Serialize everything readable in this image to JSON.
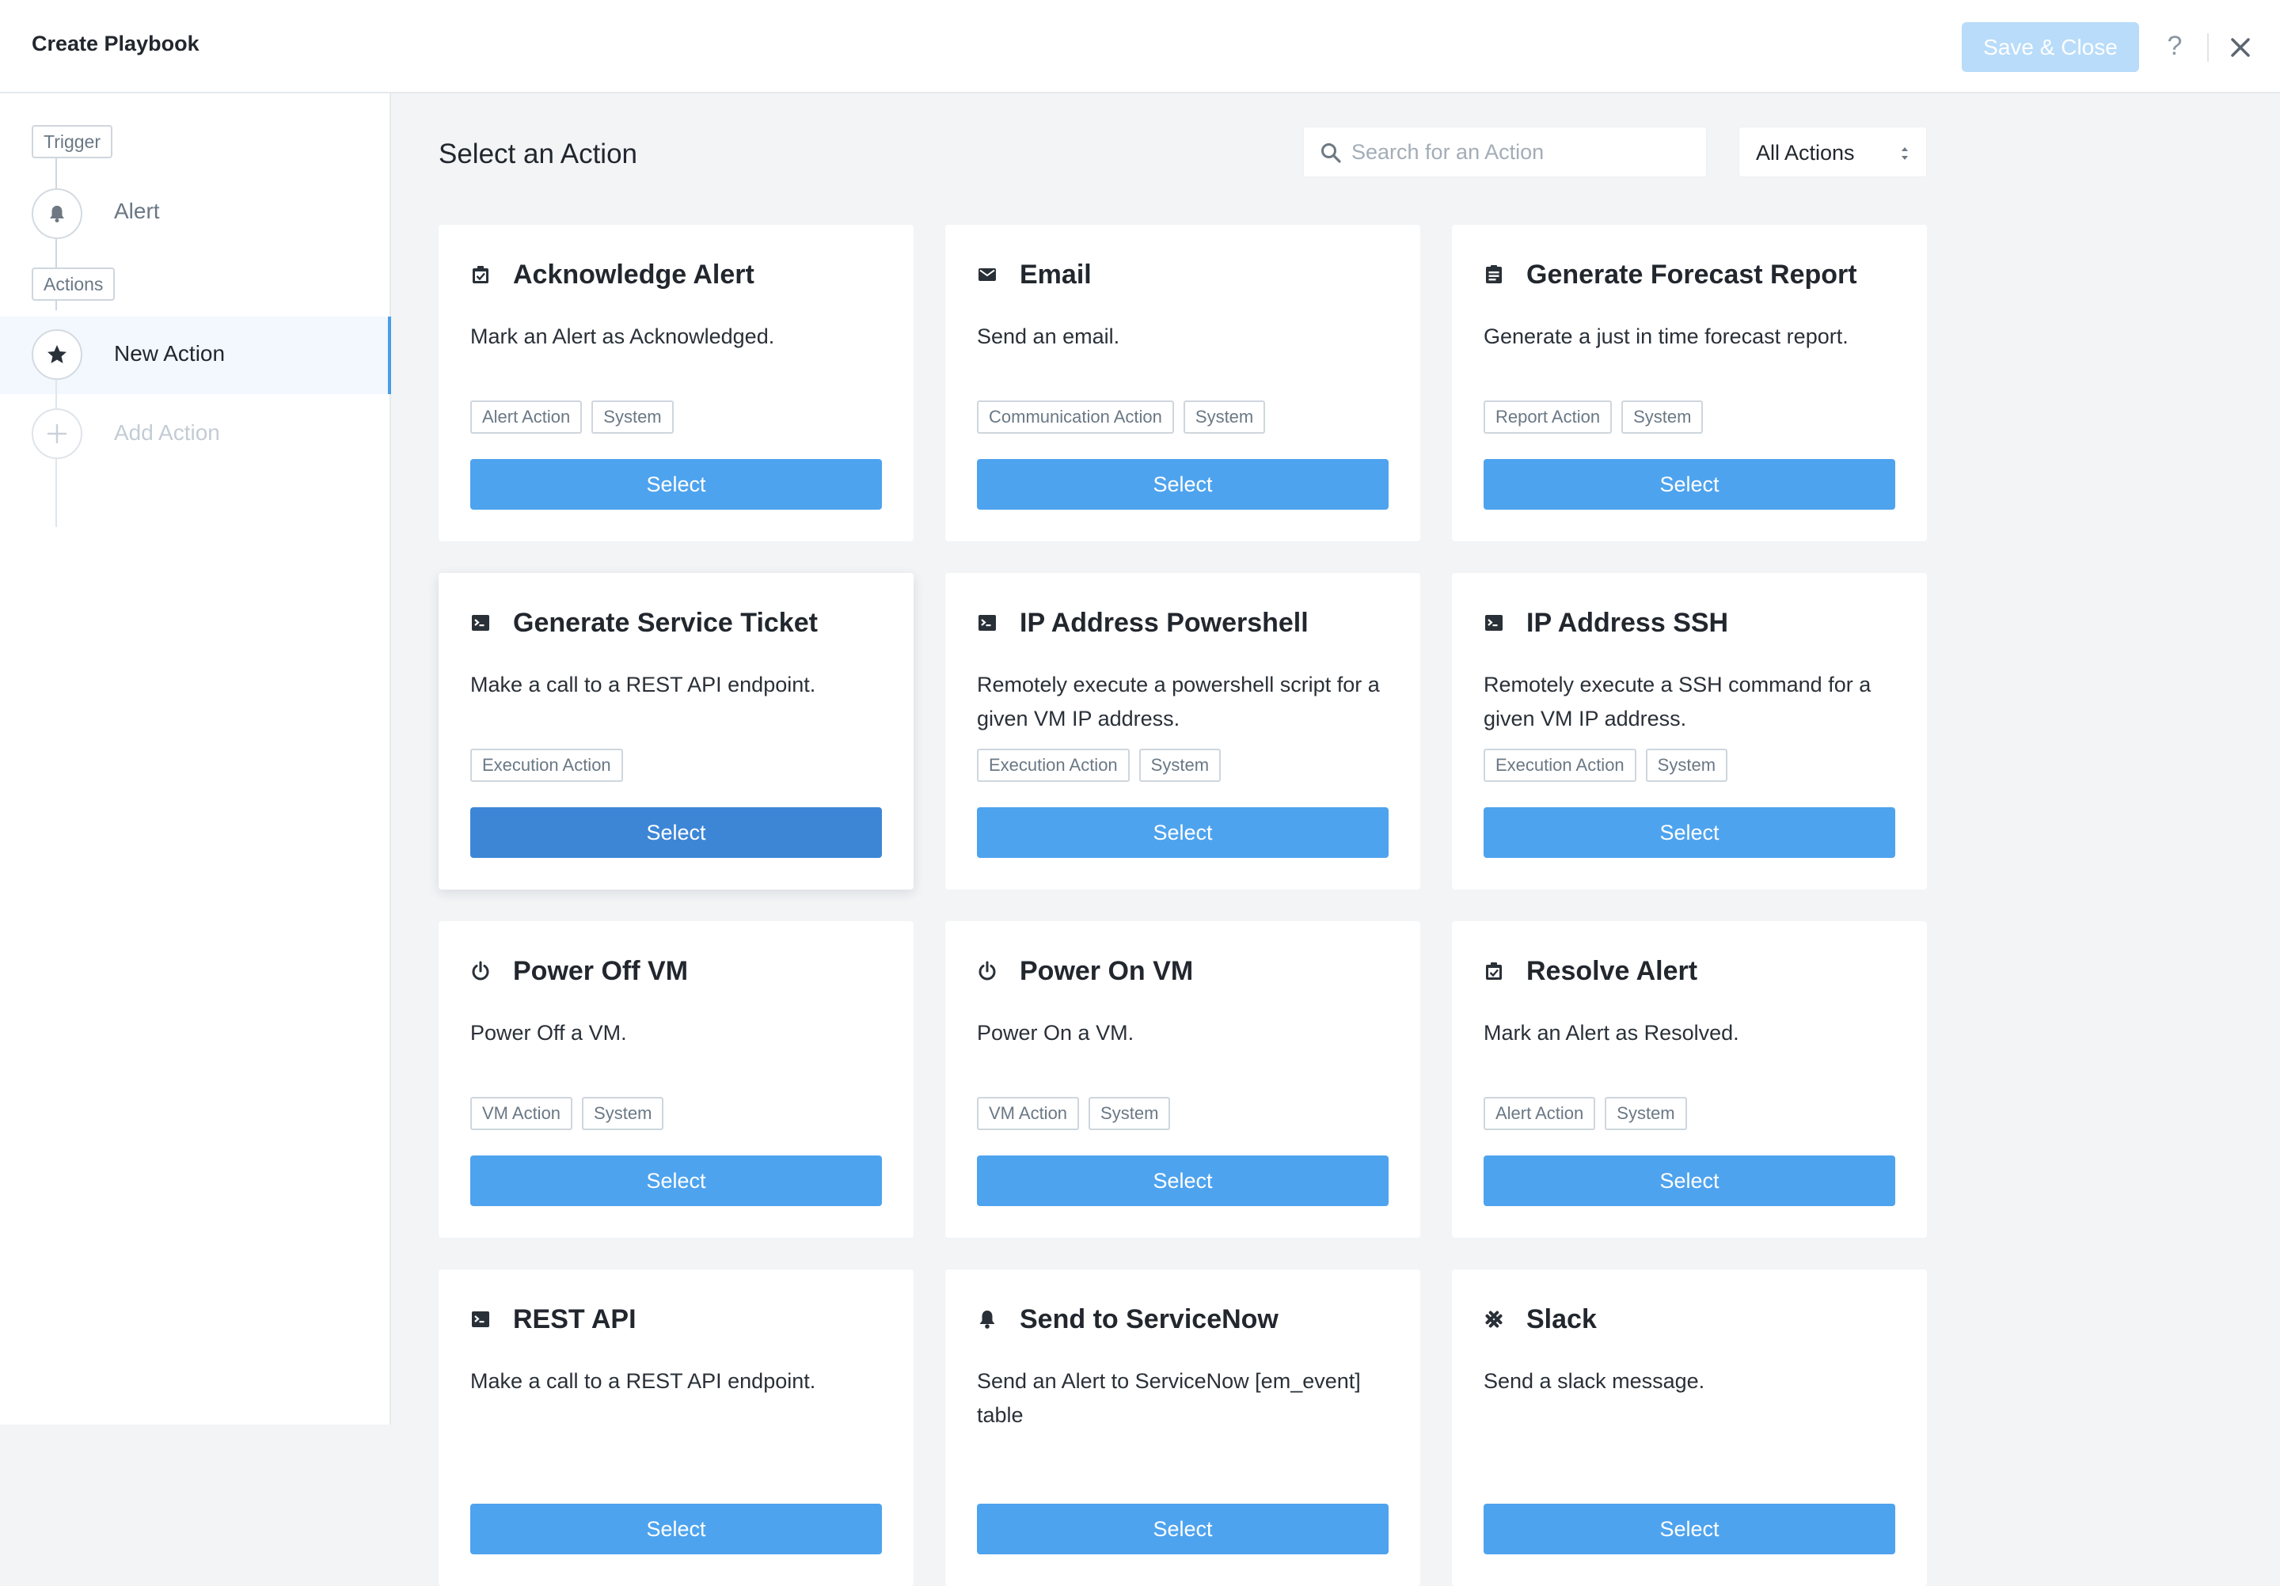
{
  "header": {
    "title": "Create Playbook",
    "save_label": "Save & Close",
    "help_label": "?"
  },
  "sidebar": {
    "trigger_label": "Trigger",
    "trigger_item": "Alert",
    "actions_label": "Actions",
    "new_action": "New Action",
    "add_action": "Add Action"
  },
  "main": {
    "title": "Select an Action",
    "search_placeholder": "Search for an Action",
    "filter_value": "All Actions",
    "cards": [
      {
        "title": "Acknowledge Alert",
        "desc": "Mark an Alert as Acknowledged.",
        "tags": [
          "Alert Action",
          "System"
        ],
        "icon": "clipboard-check-icon",
        "button": "Select"
      },
      {
        "title": "Email",
        "desc": "Send an email.",
        "tags": [
          "Communication Action",
          "System"
        ],
        "icon": "envelope-icon",
        "button": "Select"
      },
      {
        "title": "Generate Forecast Report",
        "desc": "Generate a just in time forecast report.",
        "tags": [
          "Report Action",
          "System"
        ],
        "icon": "report-icon",
        "button": "Select"
      },
      {
        "title": "Generate Service Ticket",
        "desc": "Make a call to a REST API endpoint.",
        "tags": [
          "Execution Action"
        ],
        "icon": "terminal-icon",
        "button": "Select"
      },
      {
        "title": "IP Address Powershell",
        "desc": "Remotely execute a powershell script for a given VM IP address.",
        "tags": [
          "Execution Action",
          "System"
        ],
        "icon": "terminal-icon",
        "button": "Select"
      },
      {
        "title": "IP Address SSH",
        "desc": "Remotely execute a SSH command for a given VM IP address.",
        "tags": [
          "Execution Action",
          "System"
        ],
        "icon": "terminal-icon",
        "button": "Select"
      },
      {
        "title": "Power Off VM",
        "desc": "Power Off a VM.",
        "tags": [
          "VM Action",
          "System"
        ],
        "icon": "power-icon",
        "button": "Select"
      },
      {
        "title": "Power On VM",
        "desc": "Power On a VM.",
        "tags": [
          "VM Action",
          "System"
        ],
        "icon": "power-icon",
        "button": "Select"
      },
      {
        "title": "Resolve Alert",
        "desc": "Mark an Alert as Resolved.",
        "tags": [
          "Alert Action",
          "System"
        ],
        "icon": "clipboard-check-icon",
        "button": "Select"
      },
      {
        "title": "REST API",
        "desc": "Make a call to a REST API endpoint.",
        "tags": [],
        "icon": "terminal-icon",
        "button": "Select"
      },
      {
        "title": "Send to ServiceNow",
        "desc": "Send an Alert to ServiceNow [em_event] table",
        "tags": [],
        "icon": "bell-icon",
        "button": "Select"
      },
      {
        "title": "Slack",
        "desc": "Send a slack message.",
        "tags": [],
        "icon": "slack-icon",
        "button": "Select"
      }
    ]
  },
  "colors": {
    "accent": "#4ea3ee",
    "accent_hover": "#3d86d6",
    "save_disabled": "#b8dcf9",
    "background": "#f2f4f6"
  }
}
